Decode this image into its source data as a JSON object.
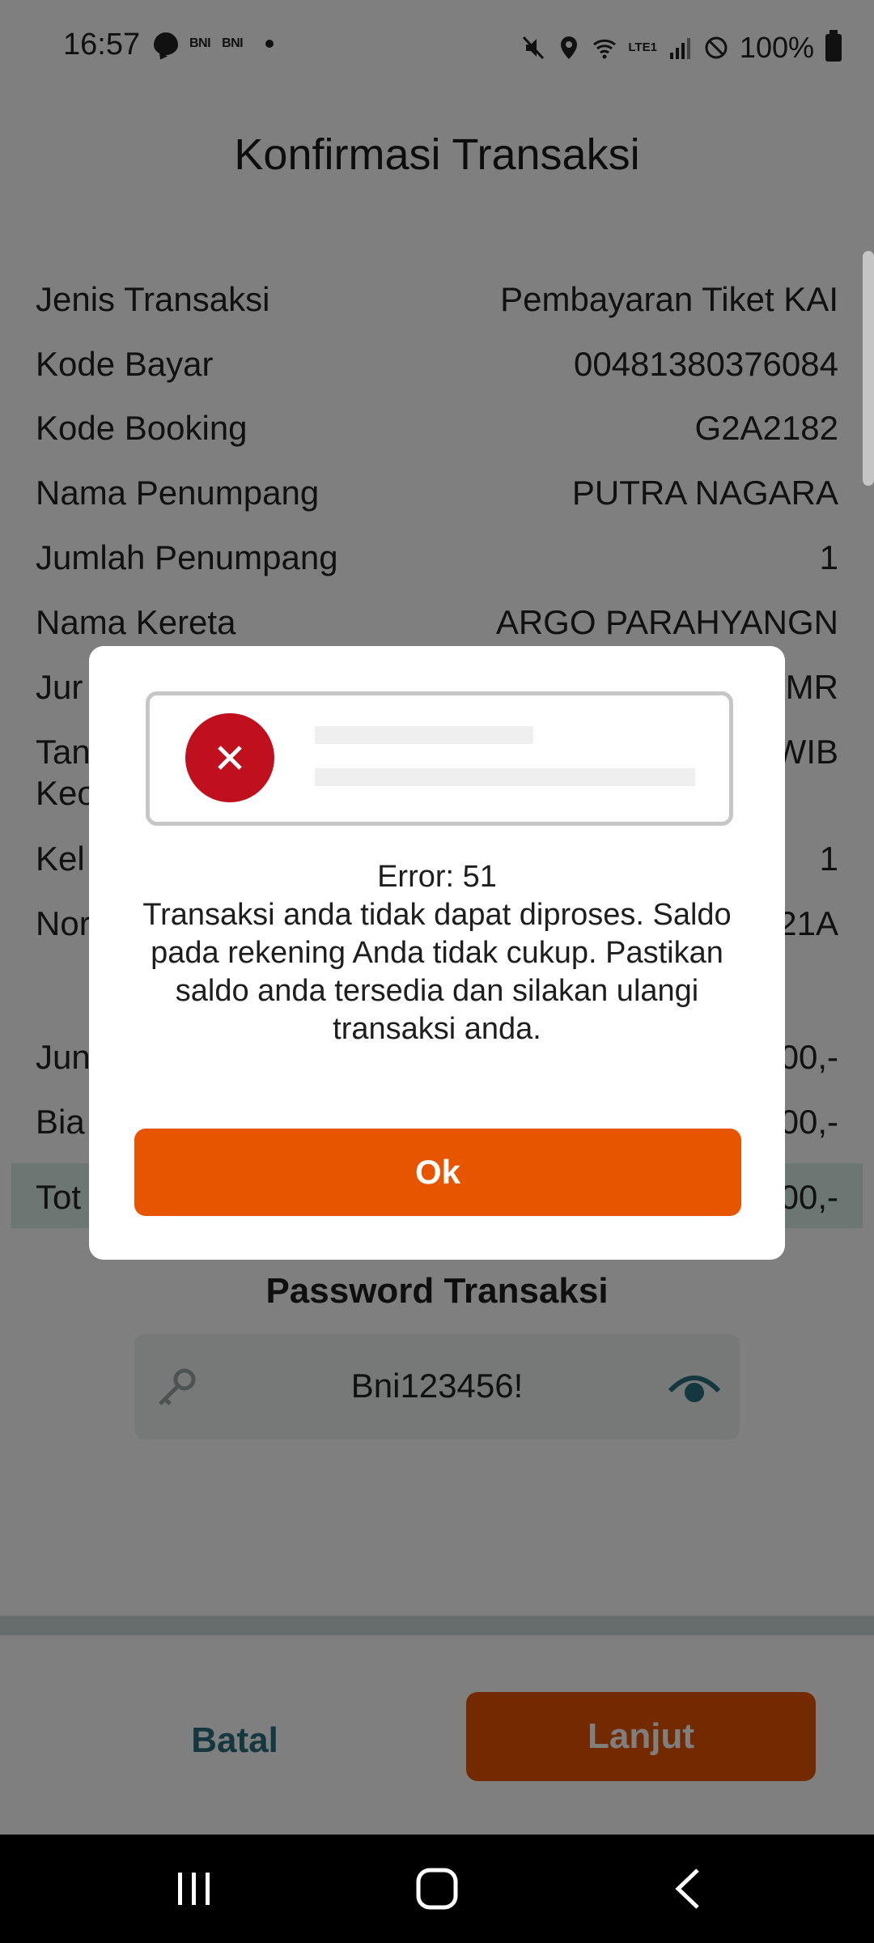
{
  "status_bar": {
    "time": "16:57",
    "notif_1": "BNI",
    "notif_2": "BNI",
    "battery": "100%",
    "network": "LTE1"
  },
  "header": {
    "title": "Konfirmasi Transaksi"
  },
  "details": [
    {
      "label": "Jenis Transaksi",
      "value": "Pembayaran Tiket KAI"
    },
    {
      "label": "Kode Bayar",
      "value": "00481380376084"
    },
    {
      "label": "Kode Booking",
      "value": "G2A2182"
    },
    {
      "label": "Nama Penumpang",
      "value": "PUTRA NAGARA"
    },
    {
      "label": "Jumlah Penumpang",
      "value": "1"
    },
    {
      "label": "Nama Kereta",
      "value": "ARGO PARAHYANGN"
    },
    {
      "label": "Jur",
      "value": "MR"
    },
    {
      "label": "Tan",
      "value": "WIB"
    },
    {
      "label": "Keo",
      "value": ""
    },
    {
      "label": "Kel",
      "value": "1"
    },
    {
      "label": "Nor",
      "value": "21A"
    }
  ],
  "amounts": [
    {
      "label": "Jun",
      "value": "00,-"
    },
    {
      "label": "Bia",
      "value": "00,-"
    },
    {
      "label": "Tot",
      "value": "00,-"
    }
  ],
  "password": {
    "title": "Password Transaksi",
    "value": "Bni123456!"
  },
  "actions": {
    "cancel": "Batal",
    "next": "Lanjut"
  },
  "dialog": {
    "error_code": "Error: 51",
    "message": "Transaksi anda tidak dapat diproses. Saldo pada rekening Anda tidak cukup. Pastikan saldo anda tersedia dan silakan ulangi transaksi anda.",
    "ok_label": "Ok"
  },
  "colors": {
    "accent": "#E85500",
    "error": "#C0101D",
    "teal": "#2B6E80",
    "total_bg": "#D9EFE9"
  },
  "icons": [
    "chat-icon",
    "mute-icon",
    "location-icon",
    "wifi-icon",
    "signal-icon",
    "dnd-icon",
    "battery-icon",
    "key-icon",
    "eye-icon",
    "error-x-icon",
    "recent-apps-icon",
    "home-icon",
    "back-icon"
  ]
}
